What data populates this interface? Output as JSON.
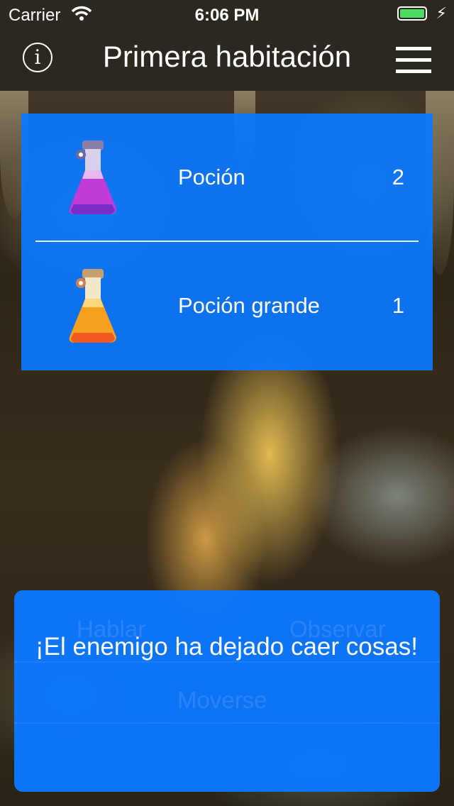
{
  "status_bar": {
    "carrier": "Carrier",
    "time": "6:06 PM",
    "battery_level": 1.0
  },
  "nav_bar": {
    "info_glyph": "i",
    "title": "Primera habitación"
  },
  "inventory": [
    {
      "name": "Poción",
      "count": "2",
      "icon": "purple-potion-icon"
    },
    {
      "name": "Poción grande",
      "count": "1",
      "icon": "orange-potion-icon"
    }
  ],
  "actions": {
    "talk": "Hablar",
    "observe": "Observar",
    "move": "Moverse"
  },
  "message": "¡El enemigo ha dejado caer cosas!",
  "colors": {
    "panel_blue": "#0c78ff",
    "bar_dark": "#2b2820",
    "battery_green": "#4cd964"
  }
}
